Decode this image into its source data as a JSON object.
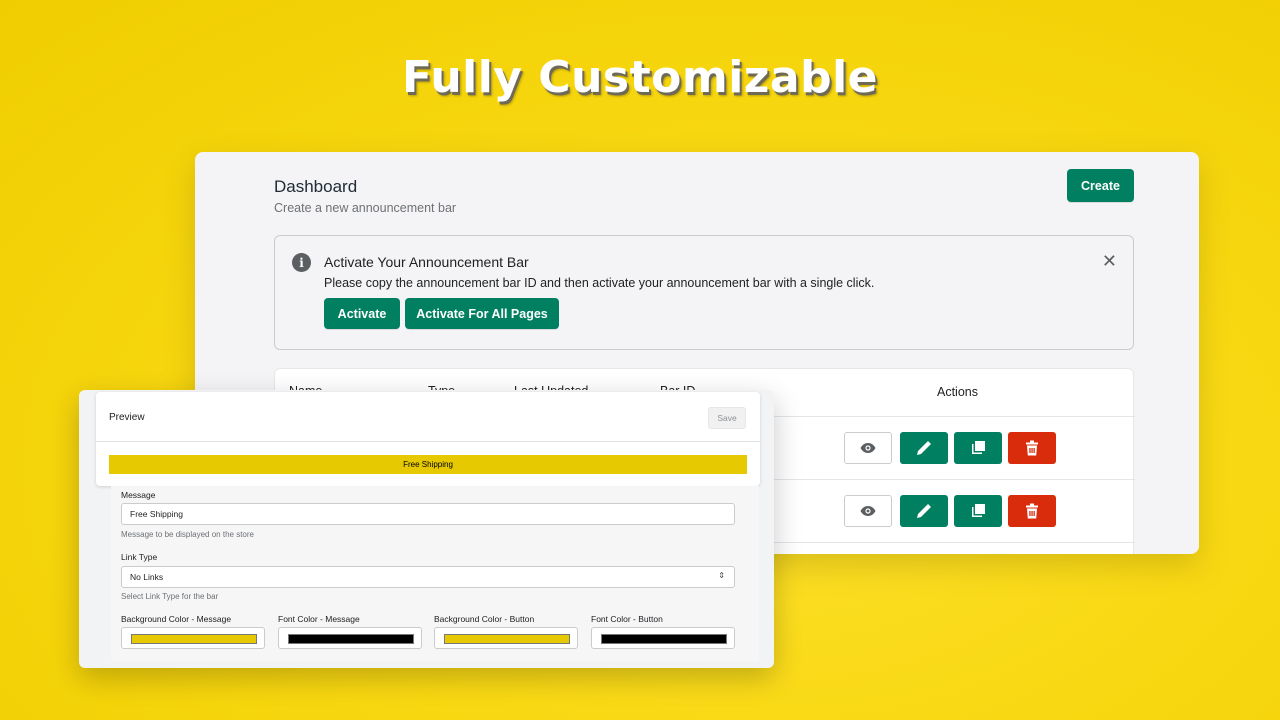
{
  "headline": "Fully Customizable",
  "colors": {
    "primary": "#008060",
    "danger": "#d82c0d",
    "bar_background": "#e6c900",
    "bar_font": "#000000",
    "button_background": "#e6c900",
    "button_font": "#000000"
  },
  "dashboard": {
    "title": "Dashboard",
    "subtitle": "Create a new announcement bar",
    "create_label": "Create",
    "banner": {
      "icon": "info-icon",
      "icon_glyph": "i",
      "title": "Activate Your Announcement Bar",
      "text": "Please copy the announcement bar ID and then activate your announcement bar with a single click.",
      "activate_label": "Activate",
      "activate_all_label": "Activate For All Pages",
      "close_glyph": "✕"
    },
    "table": {
      "columns": [
        "Name",
        "Type",
        "Last Updated",
        "Bar ID",
        "Actions"
      ],
      "rows": [
        {
          "actions": [
            "view",
            "edit",
            "duplicate",
            "delete"
          ]
        },
        {
          "actions": [
            "view",
            "edit",
            "duplicate",
            "delete"
          ]
        }
      ]
    }
  },
  "preview": {
    "title": "Preview",
    "save_label": "Save",
    "bar_text": "Free Shipping",
    "form": {
      "message_label": "Message",
      "message_value": "Free Shipping",
      "message_help": "Message to be displayed on the store",
      "link_type_label": "Link Type",
      "link_type_value": "No Links",
      "link_type_help": "Select Link Type for the bar",
      "color_fields": [
        {
          "label": "Background Color - Message",
          "value": "#e6c900"
        },
        {
          "label": "Font Color - Message",
          "value": "#000000"
        },
        {
          "label": "Background Color - Button",
          "value": "#e6c900"
        },
        {
          "label": "Font Color - Button",
          "value": "#000000"
        }
      ]
    }
  }
}
